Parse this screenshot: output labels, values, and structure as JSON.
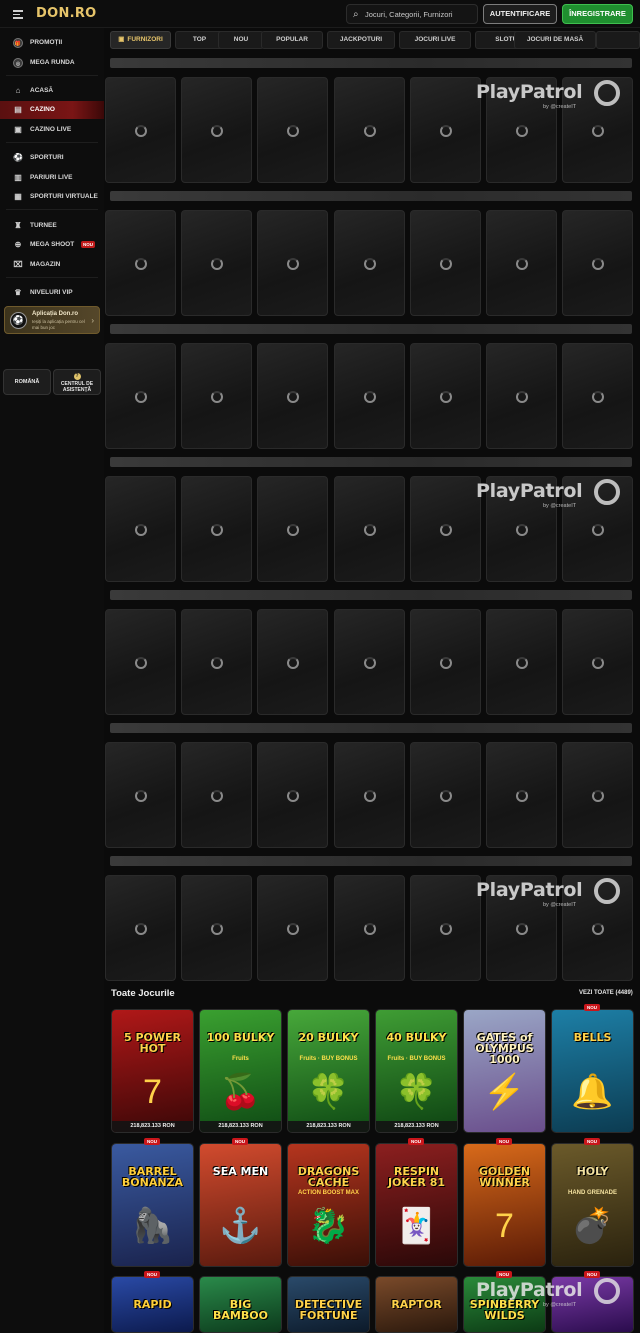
{
  "header": {
    "logo": "DON.RO",
    "search_placeholder": "Jocuri, Categorii, Furnizori",
    "login_label": "AUTENTIFICARE",
    "register_label": "ÎNREGISTRARE",
    "register_color": "#1f8f2f"
  },
  "sidebar": {
    "items": [
      {
        "label": "PROMOȚII",
        "icon": "gift-icon"
      },
      {
        "label": "MEGA RUNDA",
        "icon": "wheel-icon"
      },
      {
        "label": "ACASĂ",
        "icon": "home-icon"
      },
      {
        "label": "CAZINO",
        "icon": "cards-icon",
        "active": true
      },
      {
        "label": "CAZINO LIVE",
        "icon": "live-dealer-icon"
      },
      {
        "label": "SPORTURI",
        "icon": "ball-icon"
      },
      {
        "label": "PARIURI LIVE",
        "icon": "live-icon"
      },
      {
        "label": "SPORTURI VIRTUALE",
        "icon": "virtual-sports-icon"
      },
      {
        "label": "TURNEE",
        "icon": "tournament-icon"
      },
      {
        "label": "MEGA SHOOT",
        "icon": "target-icon",
        "badge": "NOU"
      },
      {
        "label": "MAGAZIN",
        "icon": "shop-icon"
      },
      {
        "label": "NIVELURI VIP",
        "icon": "vip-icon"
      }
    ],
    "app_card": {
      "title": "Aplicația Don.ro",
      "text": "Ieșiți la aplicația pentru cel mai bun joc"
    },
    "language_label": "ROMÂNĂ",
    "help_label": "CENTRUL DE ASISTENȚĂ",
    "active_color": "#7a1515"
  },
  "tabs": [
    {
      "label": "FURNIZORI",
      "icon": "provider-icon"
    },
    {
      "label": "TOP"
    },
    {
      "label": "NOU"
    },
    {
      "label": "POPULAR"
    },
    {
      "label": "JACKPOTURI"
    },
    {
      "label": "JOCURI LIVE"
    },
    {
      "label": "SLOTURI"
    },
    {
      "label": "JOCURI DE MASĂ"
    },
    {
      "label": ""
    }
  ],
  "watermark": {
    "brand": "PlayPatrol",
    "by": "by @createIT"
  },
  "games_section": {
    "title": "Toate Jocurile",
    "see_all": "VEZI TOATE (4489)",
    "new_badge": "NOU",
    "games": [
      {
        "title": "5 POWER HOT",
        "subtitle": "",
        "jackpot": "218,823.133 RON",
        "symbol": "7",
        "bg": "#b01818",
        "bg2": "#3a0707",
        "fg": "#ffd24a",
        "new": false
      },
      {
        "title": "100 BULKY",
        "subtitle": "Fruits",
        "jackpot": "218,823.133 RON",
        "symbol": "🍒",
        "bg": "#3aa030",
        "bg2": "#0f4a14",
        "fg": "#ffe14a",
        "new": false
      },
      {
        "title": "20 BULKY",
        "subtitle": "Fruits · BUY BONUS",
        "jackpot": "218,823.133 RON",
        "symbol": "🍀",
        "bg": "#47a83a",
        "bg2": "#0f4a14",
        "fg": "#ffe14a",
        "new": false
      },
      {
        "title": "40 BULKY",
        "subtitle": "Fruits · BUY BONUS",
        "jackpot": "218,823.133 RON",
        "symbol": "🍀",
        "bg": "#3f9d34",
        "bg2": "#0d4212",
        "fg": "#ffe14a",
        "new": false
      },
      {
        "title": "GATES of OLYMPUS 1000",
        "subtitle": "",
        "jackpot": "",
        "symbol": "⚡",
        "bg": "#9aa6c6",
        "bg2": "#6a4e8c",
        "fg": "#fff2c0",
        "new": false
      },
      {
        "title": "BELLS",
        "subtitle": "",
        "jackpot": "",
        "symbol": "🔔",
        "bg": "#1d7fa6",
        "bg2": "#0c3c52",
        "fg": "#ffd24a",
        "new": true
      },
      {
        "title": "BARREL BONANZA",
        "subtitle": "",
        "jackpot": "",
        "symbol": "🦍",
        "bg": "#3a5aa0",
        "bg2": "#1a234d",
        "fg": "#ffcf3a",
        "new": true
      },
      {
        "title": "SEA MEN",
        "subtitle": "",
        "jackpot": "",
        "symbol": "⚓",
        "bg": "#d24b2e",
        "bg2": "#5a1a0e",
        "fg": "#ffffff",
        "new": true
      },
      {
        "title": "DRAGONS CACHE",
        "subtitle": "ACTION BOOST MAX",
        "jackpot": "",
        "symbol": "🐉",
        "bg": "#b5351e",
        "bg2": "#3a0f07",
        "fg": "#ffd24a",
        "new": false
      },
      {
        "title": "RESPIN JOKER 81",
        "subtitle": "",
        "jackpot": "",
        "symbol": "🃏",
        "bg": "#8c1f1f",
        "bg2": "#2a0808",
        "fg": "#ffd24a",
        "new": true
      },
      {
        "title": "GOLDEN WINNER",
        "subtitle": "",
        "jackpot": "",
        "symbol": "7",
        "bg": "#d86a1a",
        "bg2": "#5a1a06",
        "fg": "#ffd24a",
        "new": true
      },
      {
        "title": "HOLY",
        "subtitle": "HAND GRENADE",
        "jackpot": "",
        "symbol": "💣",
        "bg": "#6b5a2a",
        "bg2": "#2a220e",
        "fg": "#f4e2a0",
        "new": true
      },
      {
        "title": "RAPID",
        "subtitle": "",
        "jackpot": "",
        "symbol": "⚡",
        "bg": "#2a4aa6",
        "bg2": "#0c1a4d",
        "fg": "#ffcf3a",
        "new": true
      },
      {
        "title": "BIG BAMBOO",
        "subtitle": "",
        "jackpot": "",
        "symbol": "🐼",
        "bg": "#2a8a4a",
        "bg2": "#0c3a1c",
        "fg": "#ffe14a",
        "new": false
      },
      {
        "title": "DETECTIVE FORTUNE",
        "subtitle": "",
        "jackpot": "",
        "symbol": "🔍",
        "bg": "#2a4a6a",
        "bg2": "#0c1a2a",
        "fg": "#ffd24a",
        "new": false
      },
      {
        "title": "RAPTOR",
        "subtitle": "",
        "jackpot": "",
        "symbol": "🦖",
        "bg": "#7a4a2a",
        "bg2": "#2a180c",
        "fg": "#ffd24a",
        "new": false
      },
      {
        "title": "SPINBERRY WILDS",
        "subtitle": "",
        "jackpot": "",
        "symbol": "🍓",
        "bg": "#2a8a3a",
        "bg2": "#0c3a14",
        "fg": "#ffe14a",
        "new": true
      },
      {
        "title": "",
        "subtitle": "",
        "jackpot": "",
        "symbol": "🍬",
        "bg": "#7a3aa6",
        "bg2": "#2a0c4d",
        "fg": "#ffd24a",
        "new": true
      }
    ]
  }
}
